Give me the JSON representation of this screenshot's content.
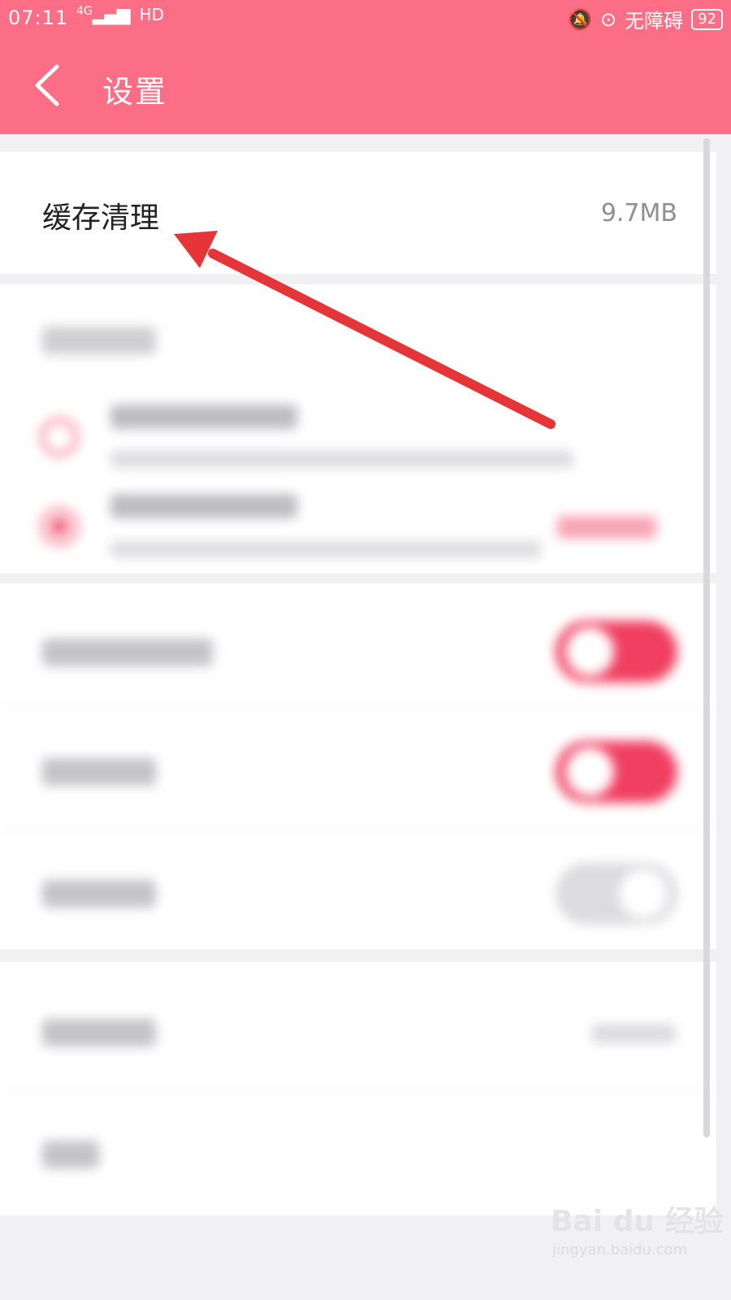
{
  "status_bar": {
    "time": "07:11",
    "network": "4G",
    "hd": "HD",
    "accessibility": "无障碍",
    "battery": "92"
  },
  "header": {
    "title": "设置"
  },
  "cache": {
    "title": "缓存清理",
    "size": "9.7MB"
  },
  "watermark": {
    "logo": "Bai du 经验",
    "url": "jingyan.baidu.com"
  },
  "colors": {
    "header_bg": "#fc6d86",
    "accent": "#f03f61",
    "arrow": "#e53539"
  }
}
